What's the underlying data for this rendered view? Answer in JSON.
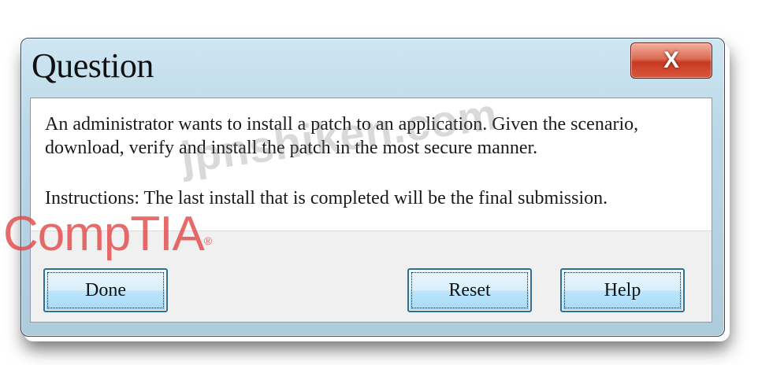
{
  "dialog": {
    "title": "Question",
    "close_label": "X",
    "message": "An administrator wants to install a patch to an application. Given the scenario, download, verify and install the patch in the most secure manner.",
    "instructions": "Instructions: The last install that is completed will be the final submission."
  },
  "buttons": {
    "done": "Done",
    "reset": "Reset",
    "help": "Help"
  },
  "watermarks": {
    "site": "jpnshiken.com",
    "brand": "CompTIA"
  },
  "colors": {
    "frame": "#bcd8e8",
    "close_button": "#d9563c",
    "button_face": "#bee6fd",
    "watermark_brand": "#e14646"
  }
}
